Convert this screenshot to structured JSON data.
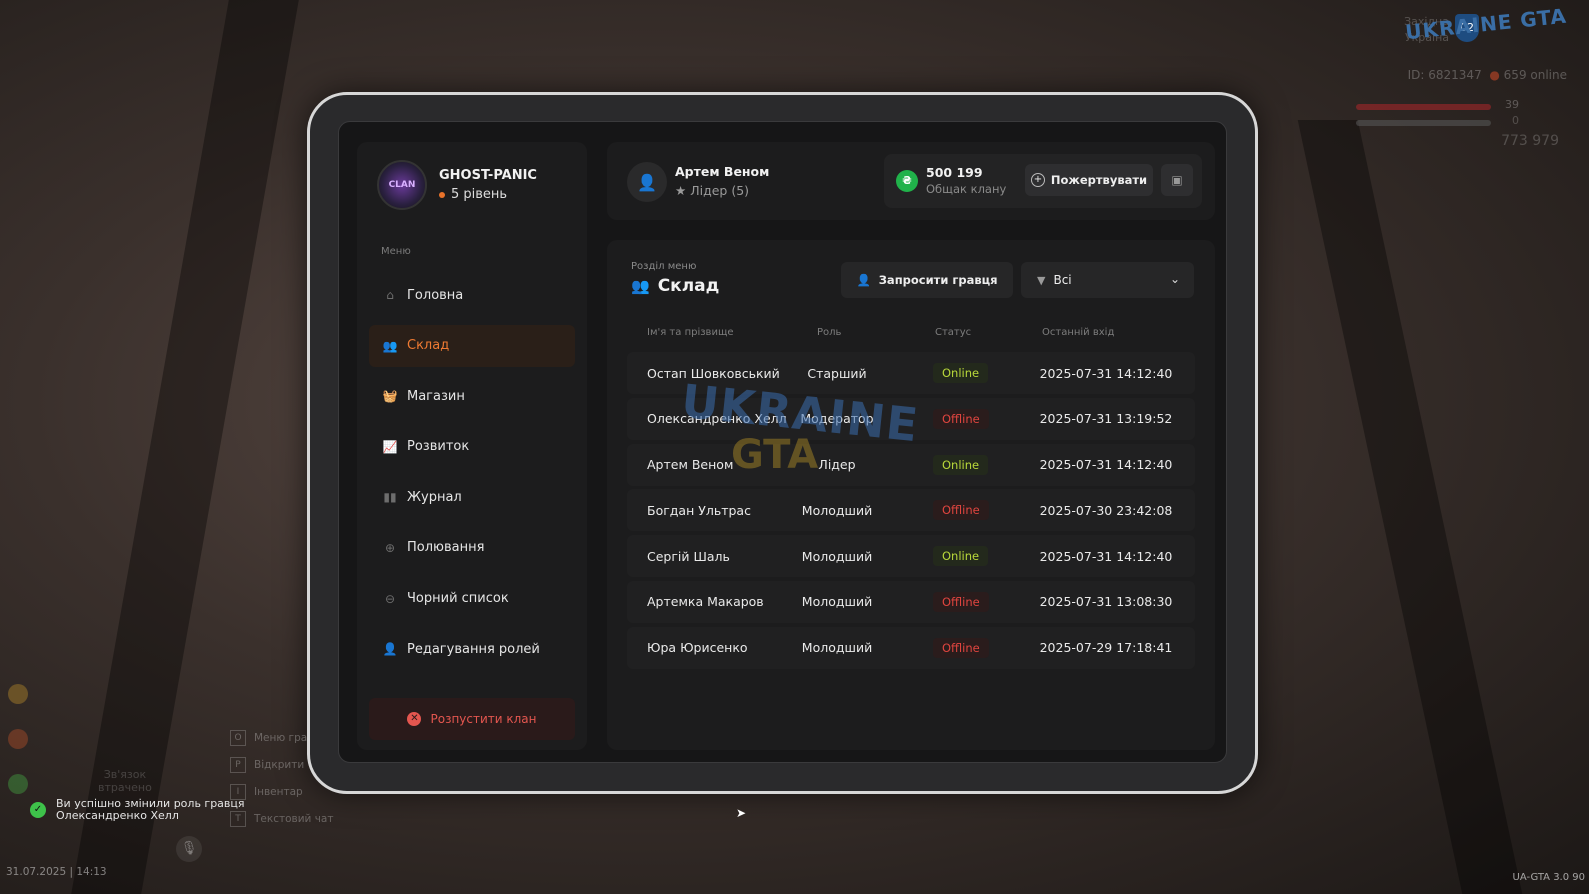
{
  "hud": {
    "logo": "UKRAINE GTA",
    "region_line1": "Західна",
    "region_line2": "Україна",
    "region_badge": "02",
    "id_line": "ID: 6821347",
    "online": "659 online",
    "health": "39",
    "armor": "0",
    "money": "773 979"
  },
  "clan": {
    "avatar_text": "CLAN",
    "name": "GHOST-PANIC",
    "level": "5 рівень"
  },
  "menu": {
    "label": "Меню",
    "items": [
      {
        "label": "Головна",
        "icon": "home-icon",
        "glyph": "⌂"
      },
      {
        "label": "Склад",
        "icon": "people-icon",
        "glyph": "👥"
      },
      {
        "label": "Магазин",
        "icon": "basket-icon",
        "glyph": "🧺"
      },
      {
        "label": "Розвиток",
        "icon": "chart-icon",
        "glyph": "📈"
      },
      {
        "label": "Журнал",
        "icon": "book-icon",
        "glyph": "▮▮"
      },
      {
        "label": "Полювання",
        "icon": "crosshair-icon",
        "glyph": "⊕"
      },
      {
        "label": "Чорний список",
        "icon": "block-icon",
        "glyph": "⊖"
      },
      {
        "label": "Редагування ролей",
        "icon": "user-edit-icon",
        "glyph": "👤"
      }
    ],
    "active_index": 1,
    "disband_label": "Розпустити клан"
  },
  "user": {
    "name": "Артем Веном",
    "role": "Лідер (5)"
  },
  "balance": {
    "value": "500 199",
    "caption": "Общак клану",
    "donate_label": "Пожертвувати"
  },
  "section": {
    "label": "Розділ меню",
    "title": "Склад",
    "invite_label": "Запросити гравця",
    "filter_value": "Всі"
  },
  "table": {
    "headers": [
      "Ім'я та прізвище",
      "Роль",
      "Статус",
      "Останній вхід"
    ],
    "rows": [
      {
        "name": "Остап Шовковський",
        "role": "Старший",
        "status": "Online",
        "last": "2025-07-31 14:12:40"
      },
      {
        "name": "Олександренко Хелл",
        "role": "Модератор",
        "status": "Offline",
        "last": "2025-07-31 13:19:52"
      },
      {
        "name": "Артем Веном",
        "role": "Лідер",
        "status": "Online",
        "last": "2025-07-31 14:12:40"
      },
      {
        "name": "Богдан Ультрас",
        "role": "Молодший",
        "status": "Offline",
        "last": "2025-07-30 23:42:08"
      },
      {
        "name": "Сергій Шаль",
        "role": "Молодший",
        "status": "Online",
        "last": "2025-07-31 14:12:40"
      },
      {
        "name": "Артемка Макаров",
        "role": "Молодший",
        "status": "Offline",
        "last": "2025-07-31 13:08:30"
      },
      {
        "name": "Юра Юрисенко",
        "role": "Молодший",
        "status": "Offline",
        "last": "2025-07-29 17:18:41"
      }
    ]
  },
  "watermark": {
    "line1": "UKRAINE",
    "line2": "GTA"
  },
  "toast": {
    "line1": "Ви успішно змінили роль гравця",
    "line2": "Олександренко Хелл"
  },
  "keys": [
    {
      "key": "O",
      "label": "Меню гра"
    },
    {
      "key": "P",
      "label": "Відкрити"
    },
    {
      "key": "I",
      "label": "Інвентар"
    },
    {
      "key": "T",
      "label": "Текстовий чат"
    }
  ],
  "voice": {
    "line1": "Зв'язок",
    "line2": "втрачено"
  },
  "datetime": "31.07.2025 | 14:13",
  "version": "UA-GTA 3.0  90",
  "colors": {
    "accent": "#ef7a32",
    "online": "#b9d83a",
    "offline": "#e0453f",
    "coin": "#20b24a",
    "danger": "#e3564f"
  }
}
